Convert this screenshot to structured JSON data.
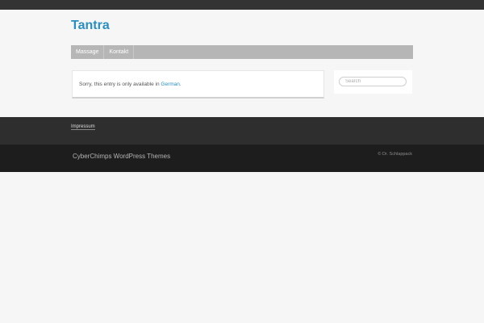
{
  "site": {
    "title": "Tantra"
  },
  "nav": {
    "items": [
      {
        "label": "Massage"
      },
      {
        "label": "Kontakt"
      }
    ]
  },
  "content": {
    "notice_prefix": "Sorry, this entry is only available in ",
    "notice_link": "German",
    "notice_suffix": "."
  },
  "sidebar": {
    "search_placeholder": "Search"
  },
  "footer": {
    "link": "Impressum",
    "credit": "CyberChimps WordPress Themes",
    "copyright": "© Dr. Schlappack"
  },
  "colors": {
    "accent": "#2b8ec1",
    "nav_bg": "#b6b6b6",
    "footer_dark": "#2e2e2e",
    "footer_darker": "#1d1d1d"
  }
}
